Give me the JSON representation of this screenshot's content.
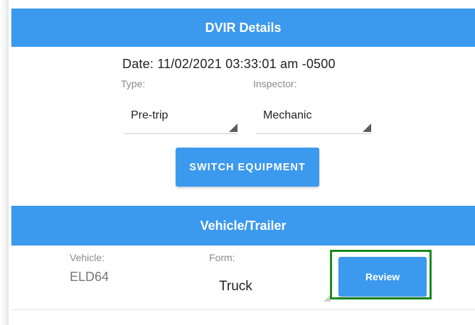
{
  "dvir_section": {
    "title": "DVIR Details",
    "date": "Date: 11/02/2021 03:33:01 am -0500",
    "type_label": "Type:",
    "type_value": "Pre-trip",
    "inspector_label": "Inspector:",
    "inspector_value": "Mechanic",
    "switch_equipment_label": "SWITCH EQUIPMENT"
  },
  "vehicle_section": {
    "title": "Vehicle/Trailer",
    "vehicle_label": "Vehicle:",
    "vehicle_value": "ELD64",
    "form_label": "Form:",
    "form_value": "Truck",
    "review_label": "Review"
  },
  "colors": {
    "accent": "#3b99ee",
    "highlight": "#1a8a1f"
  }
}
